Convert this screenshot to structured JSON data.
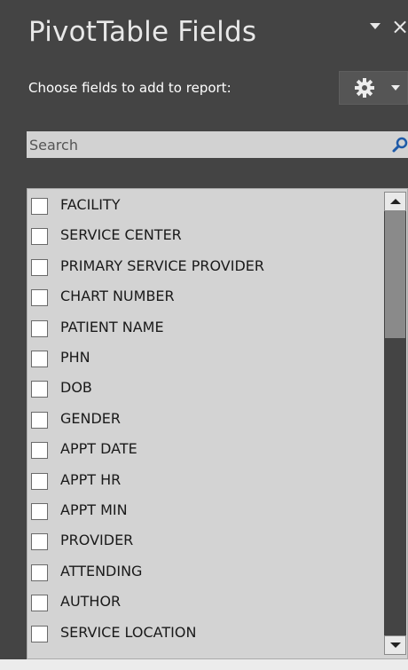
{
  "pane": {
    "title": "PivotTable Fields",
    "close_glyph": "×",
    "subtitle": "Choose fields to add to report:"
  },
  "search": {
    "placeholder": "Search"
  },
  "fields": [
    "FACILITY",
    "SERVICE CENTER",
    "PRIMARY SERVICE PROVIDER",
    "CHART NUMBER",
    "PATIENT NAME",
    "PHN",
    "DOB",
    "GENDER",
    "APPT DATE",
    "APPT HR",
    "APPT MIN",
    "PROVIDER",
    "ATTENDING",
    "AUTHOR",
    "SERVICE LOCATION"
  ],
  "scroll": {
    "visible_fraction": 0.3,
    "position_fraction": 0
  },
  "icons": {
    "title_menu": "dropdown-arrow-icon",
    "close": "close-icon",
    "tools": "gear-icon",
    "tools_menu": "chevron-down-icon",
    "search": "search-icon",
    "scroll_up": "scroll-up-icon",
    "scroll_down": "scroll-down-icon"
  },
  "colors": {
    "pane_background": "#444444",
    "list_background": "#d3d3d3",
    "search_background": "#d2d2d2",
    "search_icon": "#1e5aa8",
    "text_light": "#e8e8e8",
    "text_dark": "#1a1a1a"
  }
}
